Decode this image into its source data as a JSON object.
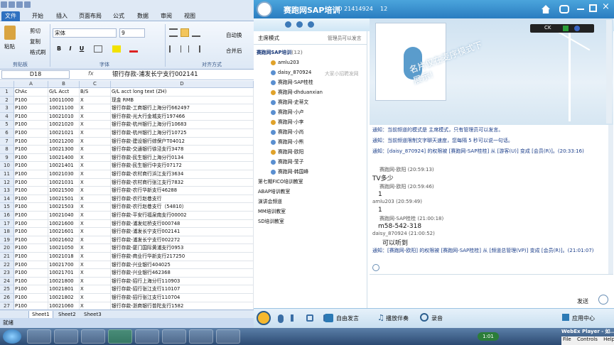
{
  "excel": {
    "ribbon_tabs": [
      "文件",
      "开始",
      "插入",
      "页面布局",
      "公式",
      "数据",
      "审阅",
      "视图"
    ],
    "clipboard": {
      "paste": "粘贴",
      "cut": "剪切",
      "copy": "复制",
      "format_painter": "格式刷",
      "group": "剪贴板"
    },
    "font": {
      "name": "宋体",
      "size": "9",
      "bold": "B",
      "italic": "I",
      "underline": "U",
      "group": "字体"
    },
    "align": {
      "group": "对齐方式",
      "wrap": "自动换",
      "merge": "合并后"
    },
    "name_box": "D18",
    "fx": "fx",
    "formula": "银行存款-浦发长宁支行002141",
    "columns": [
      "A",
      "B",
      "C",
      "D"
    ],
    "rows": [
      {
        "n": "1",
        "a": "ChAc",
        "b": "G/L Acct",
        "c": "B/S",
        "d": "G/L acct long text (ZH)"
      },
      {
        "n": "2",
        "a": "P100",
        "b": "10011000",
        "c": "X",
        "d": "现金 RMB"
      },
      {
        "n": "3",
        "a": "P100",
        "b": "10021100",
        "c": "X",
        "d": "银行存款-工商银行上海分行662497"
      },
      {
        "n": "4",
        "a": "P100",
        "b": "10021010",
        "c": "X",
        "d": "银行存款-光大行金城支行197466"
      },
      {
        "n": "5",
        "a": "P100",
        "b": "10021020",
        "c": "X",
        "d": "银行存款-杭州银行上海分行10683"
      },
      {
        "n": "6",
        "a": "P100",
        "b": "10021021",
        "c": "X",
        "d": "银行存款-杭州银行上海分行10725"
      },
      {
        "n": "7",
        "a": "P100",
        "b": "10021200",
        "c": "X",
        "d": "银行存款-建设银行综保户T04012"
      },
      {
        "n": "8",
        "a": "P100",
        "b": "10021300",
        "c": "X",
        "d": "银行存款-交通银行徐泾支行3478"
      },
      {
        "n": "9",
        "a": "P100",
        "b": "10021400",
        "c": "X",
        "d": "银行存款-民生银行上海分行0134"
      },
      {
        "n": "10",
        "a": "P100",
        "b": "10021401",
        "c": "X",
        "d": "银行存款-民生银行中支行07172"
      },
      {
        "n": "11",
        "a": "P100",
        "b": "10021030",
        "c": "X",
        "d": "银行存款-农村商行浜江支行3634"
      },
      {
        "n": "12",
        "a": "P100",
        "b": "10021031",
        "c": "X",
        "d": "银行存款-农村商行张江支行7832"
      },
      {
        "n": "13",
        "a": "P100",
        "b": "10021500",
        "c": "X",
        "d": "银行存款-农行华新支行46288"
      },
      {
        "n": "14",
        "a": "P100",
        "b": "10021501",
        "c": "X",
        "d": "银行存款-农行赵巷支行"
      },
      {
        "n": "15",
        "a": "P100",
        "b": "10021503",
        "c": "X",
        "d": "银行存款-农行赵巷支行（54810）"
      },
      {
        "n": "16",
        "a": "P100",
        "b": "10021040",
        "c": "X",
        "d": "银行存款-平安行福泉南支行00002"
      },
      {
        "n": "17",
        "a": "P100",
        "b": "10021600",
        "c": "X",
        "d": "银行存款-浦发虹桥支行000748"
      },
      {
        "n": "18",
        "a": "P100",
        "b": "10021601",
        "c": "X",
        "d": "银行存款-浦发长宁支行002141"
      },
      {
        "n": "19",
        "a": "P100",
        "b": "10021602",
        "c": "X",
        "d": "银行存款-浦发长宁支行002272"
      },
      {
        "n": "20",
        "a": "P100",
        "b": "10021050",
        "c": "X",
        "d": "银行存款-厦门国际黄浦支行0953"
      },
      {
        "n": "21",
        "a": "P100",
        "b": "10021018",
        "c": "X",
        "d": "银行存款-商业行华新支行217250"
      },
      {
        "n": "22",
        "a": "P100",
        "b": "10021700",
        "c": "X",
        "d": "银行存款-兴业银行404025"
      },
      {
        "n": "23",
        "a": "P100",
        "b": "10021701",
        "c": "X",
        "d": "银行存款-兴业银行462368"
      },
      {
        "n": "24",
        "a": "P100",
        "b": "10021800",
        "c": "X",
        "d": "银行存款-招行上海分行110903"
      },
      {
        "n": "25",
        "a": "P100",
        "b": "10021801",
        "c": "X",
        "d": "银行存款-招行张江支行110107"
      },
      {
        "n": "26",
        "a": "P100",
        "b": "10021802",
        "c": "X",
        "d": "银行存款-招行张江支行110704"
      },
      {
        "n": "27",
        "a": "P100",
        "b": "10021060",
        "c": "X",
        "d": "银行存款-浙商银行普陀支行1582"
      }
    ],
    "sheets": [
      "Sheet1",
      "Sheet2",
      "Sheet3"
    ],
    "status": "就绪"
  },
  "webex": {
    "title": "赛跑网SAP培训",
    "id": "ID 21414924",
    "count": "12",
    "mode_label": "主席模式",
    "admin_only": "管理员可以发言",
    "room": "赛跑网SAP培训",
    "room_count": "(12)",
    "members": [
      "amlu203",
      "daisy_870924",
      "赛跑网-SAP桂桂",
      "赛跑网-dhduanxian",
      "赛跑网-史蒂文",
      "赛跑网-小卢",
      "赛跑网-小李",
      "赛跑网-小尚",
      "赛跑网-小熊",
      "赛跑网-欧阳",
      "赛跑网-莹子",
      "赛跑网-韩国峰"
    ],
    "member_extra": "大家小招聘发网",
    "rooms": [
      "第七期FICO培训教室",
      "ABAP培训教室",
      "演讲会频道",
      "MM培训教室",
      "SD培训教室"
    ],
    "banner_text": "名片仅在麦序模式下展示!",
    "ck_label": "CK",
    "notices": [
      "通知：当前频道的模式是 主席模式，只有管理员可以发言。",
      "通知：当前频道限制文字聊天速度，您每隔 5 秒可以说一句话。",
      "通知：[daisy_870924] 的权限被 [赛跑网-SAP桂桂] 从 [游客(U)] 变成 [会员(R)]。(20:33:16)"
    ],
    "messages": [
      {
        "sender": "赛跑网-欧阳",
        "time": "(20:59:13)",
        "text": "TV多少"
      },
      {
        "sender": "赛跑网-欧阳",
        "time": "(20:59:46)",
        "text": "1"
      },
      {
        "sender": "amlu203",
        "time": "(20:59:49)",
        "text": "1"
      },
      {
        "sender": "赛跑网-SAP桂桂",
        "time": "(21:00:18)",
        "text": "m58-542-318"
      },
      {
        "sender": "daisy_870924",
        "time": "(21:00:52)",
        "text": "可以听到"
      }
    ],
    "last_notice": "通知：[赛跑网-欧阳] 的权限被 [赛跑网-SAP桂桂] 从 [频道总管理(VP)] 变成 [会员(R)]。(21:01:07)",
    "send": "发送",
    "bottom": {
      "free_speak": "自由发言",
      "play_song": "播放伴奏",
      "record": "录音",
      "app_center": "应用中心"
    }
  },
  "taskbar": {
    "time": "1:01",
    "webex_player": "WebEx Player - 如...",
    "file": "File",
    "controls": "Controls",
    "help": "Help"
  }
}
